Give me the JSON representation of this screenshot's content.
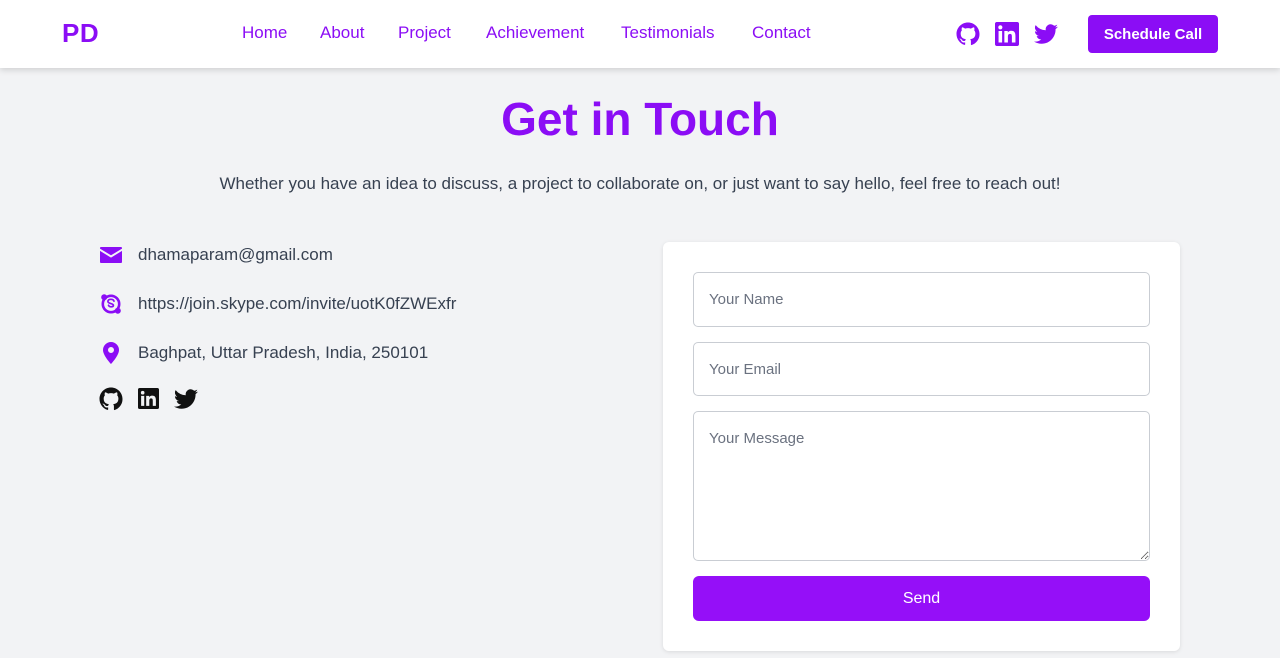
{
  "brand": {
    "logo": "PD",
    "accent": "#8b0df5"
  },
  "nav": {
    "items": [
      {
        "label": "Home"
      },
      {
        "label": "About"
      },
      {
        "label": "Project"
      },
      {
        "label": "Achievement"
      },
      {
        "label": "Testimonials"
      },
      {
        "label": "Contact"
      }
    ],
    "social_icons": [
      "github-icon",
      "linkedin-icon",
      "twitter-icon"
    ],
    "cta_label": "Schedule Call"
  },
  "contact": {
    "title": "Get in Touch",
    "subtitle": "Whether you have an idea to discuss, a project to collaborate on, or just want to say hello, feel free to reach out!",
    "info": {
      "email": "dhamaparam@gmail.com",
      "skype": "https://join.skype.com/invite/uotK0fZWExfr",
      "location": "Baghpat, Uttar Pradesh, India, 250101"
    },
    "social_icons": [
      "github-icon",
      "linkedin-icon",
      "twitter-icon"
    ]
  },
  "form": {
    "name_placeholder": "Your Name",
    "email_placeholder": "Your Email",
    "message_placeholder": "Your Message",
    "name_value": "",
    "email_value": "",
    "message_value": "",
    "send_label": "Send"
  }
}
